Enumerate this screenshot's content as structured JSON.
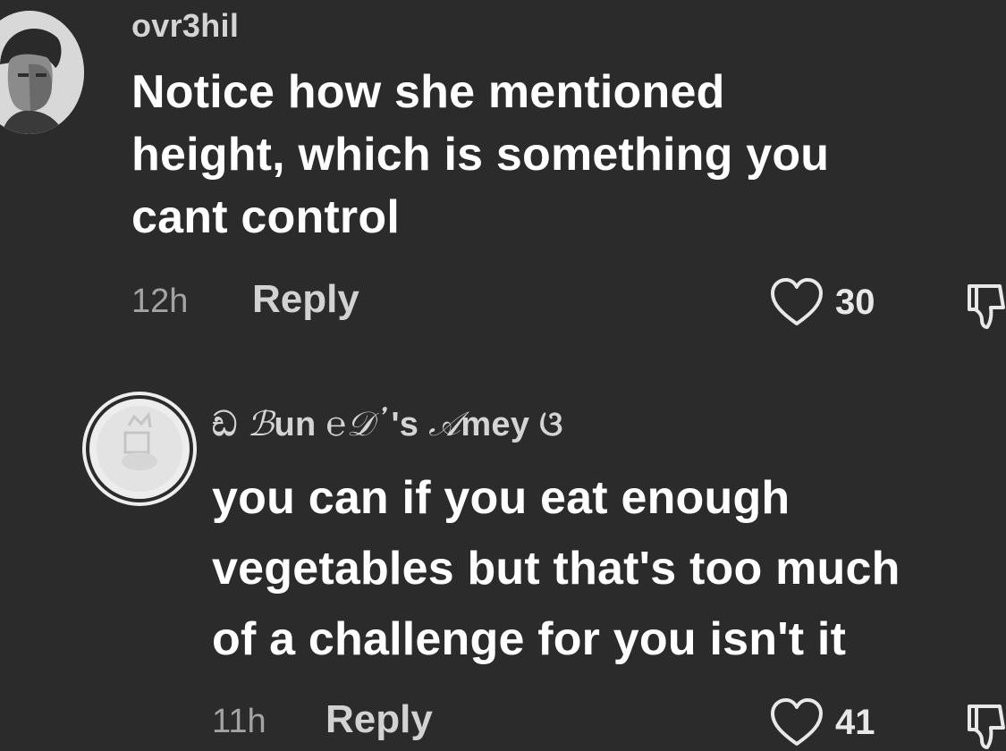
{
  "comments": [
    {
      "username": "ovr3hil",
      "body_lines": [
        "Notice how she mentioned",
        "height, which is something you",
        "cant control"
      ],
      "time": "12h",
      "reply_label": "Reply",
      "likes": "30",
      "avatar_icon": "profile-photo"
    },
    {
      "username_parts": [
        "ඩ ",
        "ℬ",
        "un ",
        "℮𝒟᾿",
        "'s ",
        "𝒜",
        "mey ",
        "ଓ"
      ],
      "body_lines": [
        "you can if you eat enough",
        "vegetables but that's too much",
        "of a challenge for you isn't it"
      ],
      "time": "11h",
      "reply_label": "Reply",
      "likes": "41",
      "avatar_icon": "profile-photo"
    }
  ],
  "icons": {
    "like": "heart-outline-icon",
    "dislike": "thumbs-down-outline-icon"
  },
  "colors": {
    "background": "#2b2b2c",
    "text_primary": "#ffffff",
    "text_secondary": "#a3a3a3"
  }
}
